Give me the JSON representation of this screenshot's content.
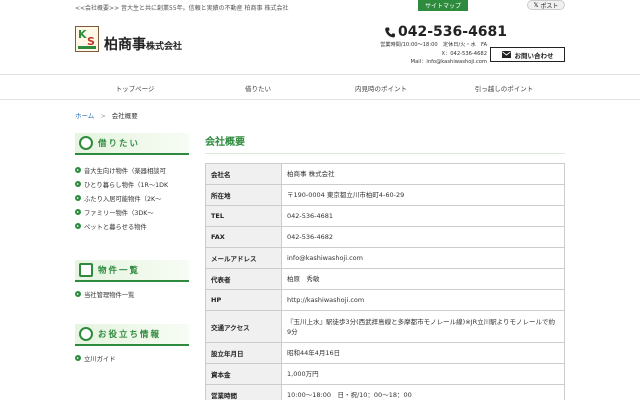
{
  "topbar": {
    "tagline": "<<会社概要>> 音大生と共に創業55年。信頼と実績の不動産 柏商事 株式会社",
    "sitemap": "サイトマップ",
    "x_post": "ポスト"
  },
  "header": {
    "company_name": "柏商事",
    "company_suffix": "株式会社",
    "phone": "042-536-4681",
    "hours_line": "営業時間/10:00～18:00　定休日/火・水　FA",
    "fax_line": "X：042-536-4682",
    "mail_line": "Mail：info@kashiwashoji.com",
    "contact_button": "お問い合わせ"
  },
  "nav": {
    "items": [
      "トップページ",
      "借りたい",
      "内見時のポイント",
      "引っ越しのポイント"
    ]
  },
  "breadcrumb": {
    "home": "ホーム",
    "separator": ">",
    "current": "会社概要"
  },
  "sidebar": {
    "sections": [
      {
        "title": "借りたい",
        "items": [
          "音大生向け物件（楽器相談可",
          "ひとり暮らし物件（1R～1DK",
          "ふたり入居可能物件（2K～",
          "ファミリー物件（3DK～",
          "ペットと暮らせる物件"
        ]
      },
      {
        "title": "物件一覧",
        "items": [
          "当社管理物件一覧"
        ]
      },
      {
        "title": "お役立ち情報",
        "items": [
          "立川ガイド"
        ]
      }
    ]
  },
  "main": {
    "title": "会社概要",
    "rows": [
      {
        "label": "会社名",
        "value": "柏商事 株式会社"
      },
      {
        "label": "所在地",
        "value": "〒190-0004 東京都立川市柏町4-60-29"
      },
      {
        "label": "TEL",
        "value": "042-536-4681"
      },
      {
        "label": "FAX",
        "value": "042-536-4682"
      },
      {
        "label": "メールアドレス",
        "value": "info@kashiwashoji.com"
      },
      {
        "label": "代表者",
        "value": "柏原　秀敏"
      },
      {
        "label": "HP",
        "value": "http://kashiwashoji.com"
      },
      {
        "label": "交通アクセス",
        "value": "『玉川上水』駅徒歩3分(西武拝島線と多摩都市モノレール線)※JR立川駅よりモノレールで約9分"
      },
      {
        "label": "設立年月日",
        "value": "昭和44年4月16日"
      },
      {
        "label": "資本金",
        "value": "1,000万円"
      },
      {
        "label": "営業時間",
        "value": "10:00～18:00　日・祝/10：00～18：00"
      }
    ]
  },
  "colors": {
    "brand_green": "#2e8b3d",
    "link_blue": "#2e6fb5"
  }
}
